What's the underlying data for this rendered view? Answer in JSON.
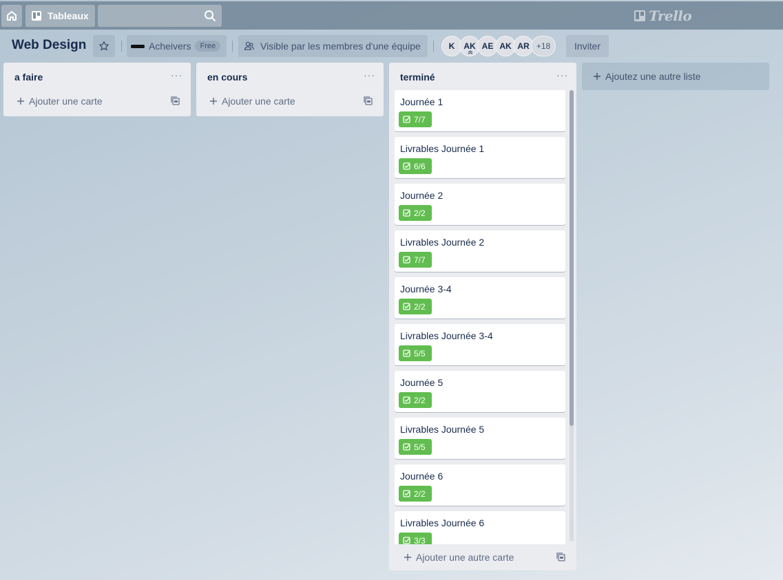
{
  "nav": {
    "boards_label": "Tableaux",
    "search_placeholder": "",
    "logo_text": "Trello"
  },
  "board": {
    "title": "Web Design",
    "team_name": "Acheivers",
    "team_plan": "Free",
    "visibility": "Visible par les membres d'une équipe",
    "invite_label": "Inviter",
    "members": [
      "K",
      "AK",
      "AE",
      "AK",
      "AR"
    ],
    "more_members": "+18"
  },
  "lists": [
    {
      "title": "a faire",
      "menu": "···",
      "add_label": "Ajouter une carte",
      "cards": []
    },
    {
      "title": "en cours",
      "menu": "···",
      "add_label": "Ajouter une carte",
      "cards": []
    },
    {
      "title": "terminé",
      "menu": "···",
      "add_label": "Ajouter une autre carte",
      "cards": [
        {
          "title": "Journée 1",
          "checklist": "7/7"
        },
        {
          "title": "Livrables Journée 1",
          "checklist": "6/6"
        },
        {
          "title": "Journée 2",
          "checklist": "2/2"
        },
        {
          "title": "Livrables Journée 2",
          "checklist": "7/7"
        },
        {
          "title": "Journée 3-4",
          "checklist": "2/2"
        },
        {
          "title": "Livrables Journée 3-4",
          "checklist": "5/5"
        },
        {
          "title": "Journée 5",
          "checklist": "2/2"
        },
        {
          "title": "Livrables Journée 5",
          "checklist": "5/5"
        },
        {
          "title": "Journée 6",
          "checklist": "2/2"
        },
        {
          "title": "Livrables Journée 6",
          "checklist": "3/3"
        }
      ]
    }
  ],
  "add_list_label": "Ajoutez une autre liste",
  "colors": {
    "checklist_complete": "#61bd4f",
    "list_bg": "#ebecf0"
  }
}
